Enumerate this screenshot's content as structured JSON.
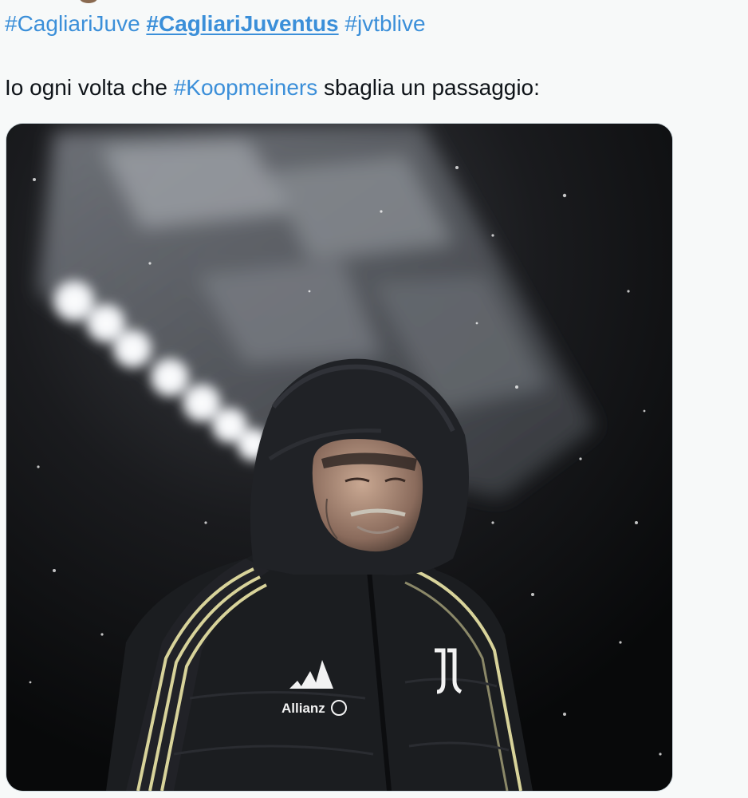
{
  "tweet": {
    "hashtags": [
      {
        "text": "#CagliariJuve",
        "style": "normal"
      },
      {
        "text": "#CagliariJuventus",
        "style": "bold-underlined"
      },
      {
        "text": "#jvtblive",
        "style": "normal"
      }
    ],
    "body": {
      "prefix": "Io ogni volta che ",
      "mention_hashtag": "#Koopmeiners",
      "suffix": " sbaglia un passaggio:"
    }
  },
  "media": {
    "jacket_brand_text": "Allianz",
    "colors": {
      "link": "#3b8fd9",
      "jacket": "#1b1d20",
      "stripe": "#d8d39a"
    }
  }
}
